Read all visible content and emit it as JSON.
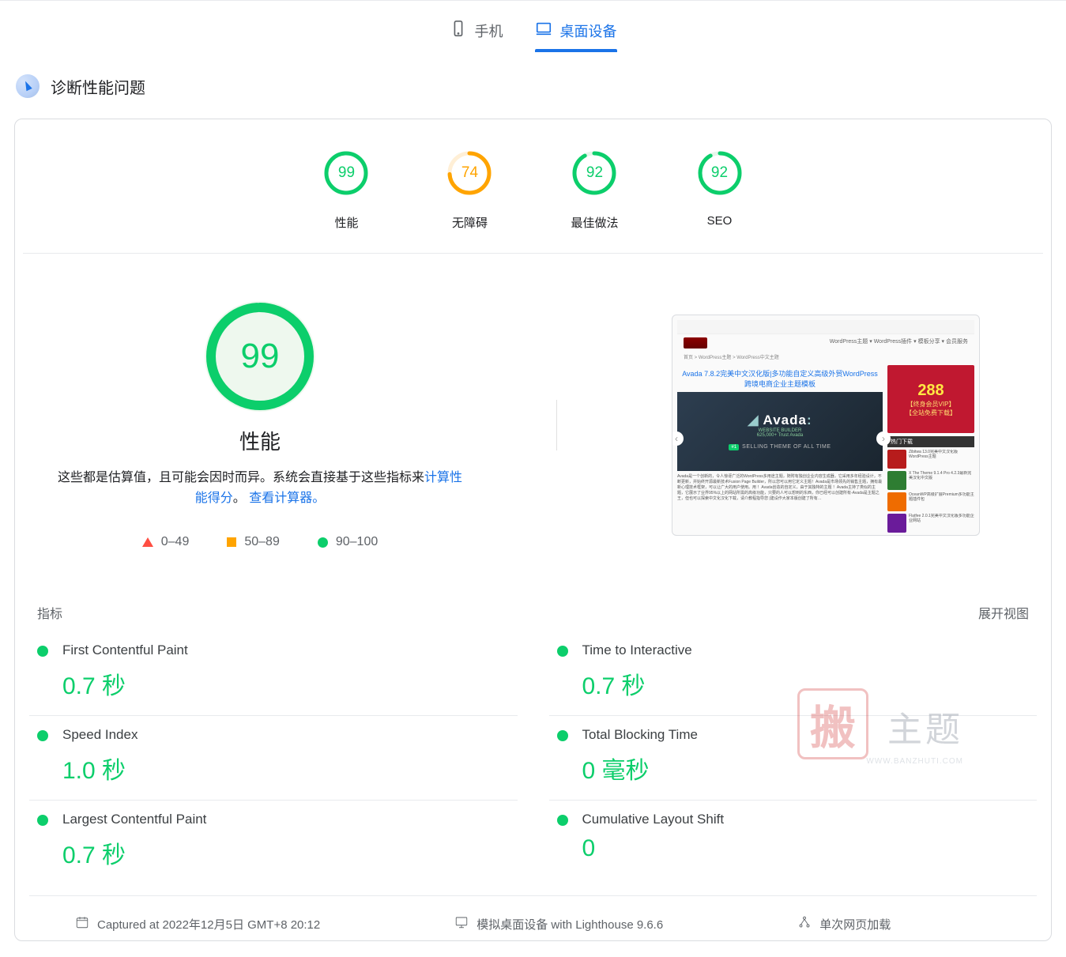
{
  "tabs": {
    "mobile": "手机",
    "desktop": "桌面设备"
  },
  "section_title": "诊断性能问题",
  "gauges": [
    {
      "value": 99,
      "label": "性能",
      "color": "#0cce6b",
      "track": "#e6f6eb"
    },
    {
      "value": 74,
      "label": "无障碍",
      "color": "#ffa400",
      "track": "#ffefd6"
    },
    {
      "value": 92,
      "label": "最佳做法",
      "color": "#0cce6b",
      "track": "#e6f6eb"
    },
    {
      "value": 92,
      "label": "SEO",
      "color": "#0cce6b",
      "track": "#e6f6eb"
    }
  ],
  "big": {
    "value": 99,
    "label": "性能"
  },
  "desc": {
    "pre": "这些都是估算值，且可能会因时而异。系统会直接基于这些指标来",
    "link1": "计算性能得分",
    "dot": "。",
    "link2": "查看计算器。"
  },
  "legend": {
    "bad": "0–49",
    "avg": "50–89",
    "good": "90–100"
  },
  "screenshot": {
    "header_items": "WordPress主题 ▾  WordPress插件 ▾  模板分享 ▾  会员服务",
    "breadcrumb": "首页 > WordPress主题 > WordPress中文主题",
    "title": "Avada 7.8.2完美中文汉化版|多功能自定义高级外贸WordPress跨境电商企业主题模板",
    "hero_brand": "Avada",
    "hero_sub": "WEBSITE BUILDER",
    "hero_tag1": "625,000+ Trust Avada",
    "hero_badge": "#1",
    "hero_tag2": "SELLING THEME OF ALL TIME",
    "ad_price": "288",
    "ad_line1": "【终身会员VIP】",
    "ad_line2": "【全站免费下载】",
    "hot_label": "热门下载"
  },
  "metrics_header": {
    "label": "指标",
    "expand": "展开视图"
  },
  "metrics": {
    "left": [
      {
        "name": "First Contentful Paint",
        "val": "0.7 秒"
      },
      {
        "name": "Speed Index",
        "val": "1.0 秒"
      },
      {
        "name": "Largest Contentful Paint",
        "val": "0.7 秒"
      }
    ],
    "right": [
      {
        "name": "Time to Interactive",
        "val": "0.7 秒"
      },
      {
        "name": "Total Blocking Time",
        "val": "0 毫秒"
      },
      {
        "name": "Cumulative Layout Shift",
        "val": "0"
      }
    ]
  },
  "footer": {
    "captured": "Captured at 2022年12月5日 GMT+8 20:12",
    "emulated": "模拟桌面设备 with Lighthouse 9.6.6",
    "load": "单次网页加载"
  },
  "watermark": {
    "stamp": "搬",
    "text": "主题",
    "url": "WWW.BANZHUTI.COM"
  }
}
